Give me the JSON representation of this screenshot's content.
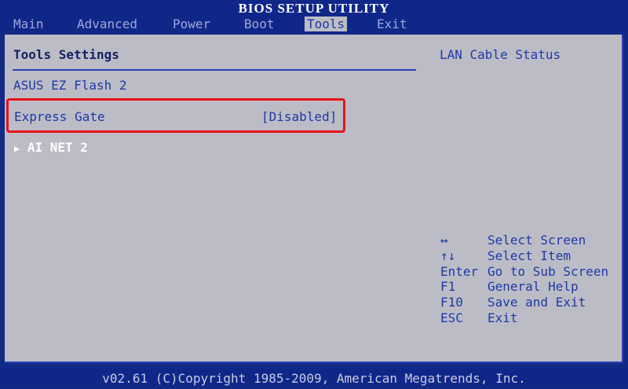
{
  "title": "BIOS SETUP UTILITY",
  "tabs": [
    {
      "label": "Main"
    },
    {
      "label": "Advanced"
    },
    {
      "label": "Power"
    },
    {
      "label": "Boot"
    },
    {
      "label": "Tools",
      "active": true
    },
    {
      "label": "Exit"
    }
  ],
  "left_panel": {
    "heading": "Tools Settings",
    "items": [
      {
        "label": "ASUS EZ Flash 2"
      },
      {
        "label": "Express Gate",
        "value": "[Disabled]",
        "highlighted": true
      }
    ],
    "submenu": {
      "arrow": "▶",
      "label": "AI NET 2"
    }
  },
  "right_panel": {
    "help_title": "LAN Cable Status",
    "keys": [
      {
        "key": "↔",
        "action": "Select Screen"
      },
      {
        "key": "↑↓",
        "action": "Select Item"
      },
      {
        "key": "Enter",
        "action": "Go to Sub Screen"
      },
      {
        "key": "F1",
        "action": "General Help"
      },
      {
        "key": "F10",
        "action": "Save and Exit"
      },
      {
        "key": "ESC",
        "action": "Exit"
      }
    ]
  },
  "footer": "v02.61 (C)Copyright 1985-2009, American Megatrends, Inc.",
  "colors": {
    "background": "#102a86",
    "panel": "#bcbcc6",
    "accent_text": "#1f3aa6",
    "highlight_border": "#e8121a"
  }
}
